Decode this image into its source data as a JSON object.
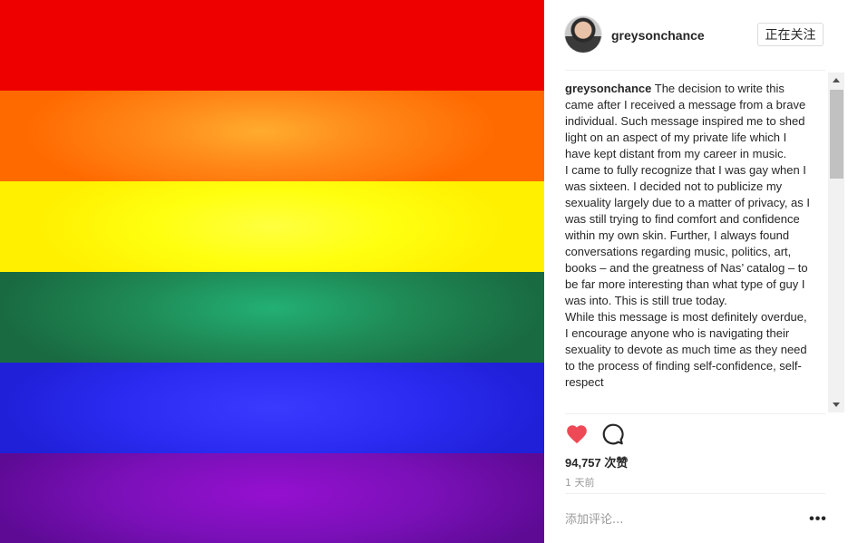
{
  "post": {
    "username": "greysonchance",
    "follow_label": "正在关注",
    "caption_username": "greysonchance",
    "caption_paragraph_1": "The decision to write this came after I received a message from a brave individual. Such message inspired me to shed light on an aspect of my private life which I have kept distant from my career in music.",
    "caption_paragraph_2": "I came to fully recognize that I was gay when I was sixteen. I decided not to publicize my sexuality largely due to a matter of privacy, as I was still trying to find comfort and confidence within my own skin. Further, I always found conversations regarding music, politics, art, books – and the greatness of Nas’ catalog – to be far more interesting than what type of guy I was into. This is still true today.",
    "caption_paragraph_3": "While this message is most definitely overdue, I encourage anyone who is navigating their sexuality to devote as much time as they need to the process of finding self-confidence, self-respect",
    "likes_count": "94,757",
    "likes_suffix": "次赞",
    "time_ago": "1 天前",
    "comment_placeholder": "添加评论...",
    "more_label": "•••"
  },
  "icons": {
    "like": "heart-icon",
    "comment": "comment-bubble-icon",
    "like_color": "#ed4956"
  },
  "image": {
    "description_colors": [
      "#ef0000",
      "#ff7a10",
      "#ffff20",
      "#1f8a55",
      "#2b2bf2",
      "#7a10b8"
    ]
  }
}
